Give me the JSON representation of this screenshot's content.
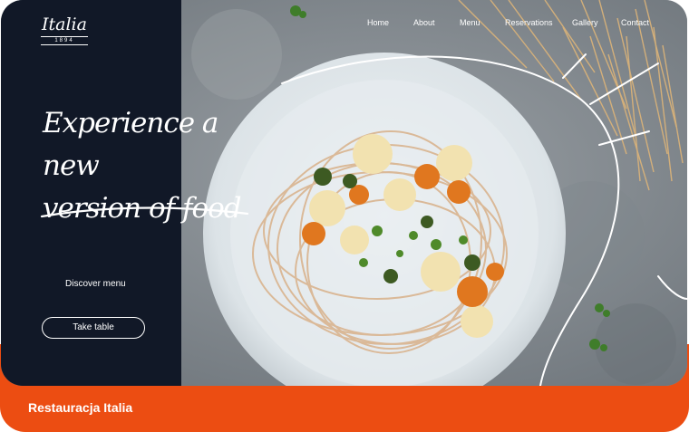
{
  "brand": {
    "name": "Italia",
    "year": "1894"
  },
  "nav": {
    "items": [
      "Home",
      "About",
      "Menu",
      "Reservations",
      "Gallery",
      "Contact"
    ]
  },
  "hero": {
    "headline_line1": "Experience a new",
    "headline_line2": "version of food",
    "discover_label": "Discover menu",
    "take_table_label": "Take table"
  },
  "footer": {
    "title": "Restauracja Italia"
  },
  "colors": {
    "sidebar": "#111827",
    "accent": "#ec4d12",
    "background_stone": "#8f959a"
  },
  "icons": [
    "pasta-plate-photo",
    "parsley-sprig-icon"
  ]
}
